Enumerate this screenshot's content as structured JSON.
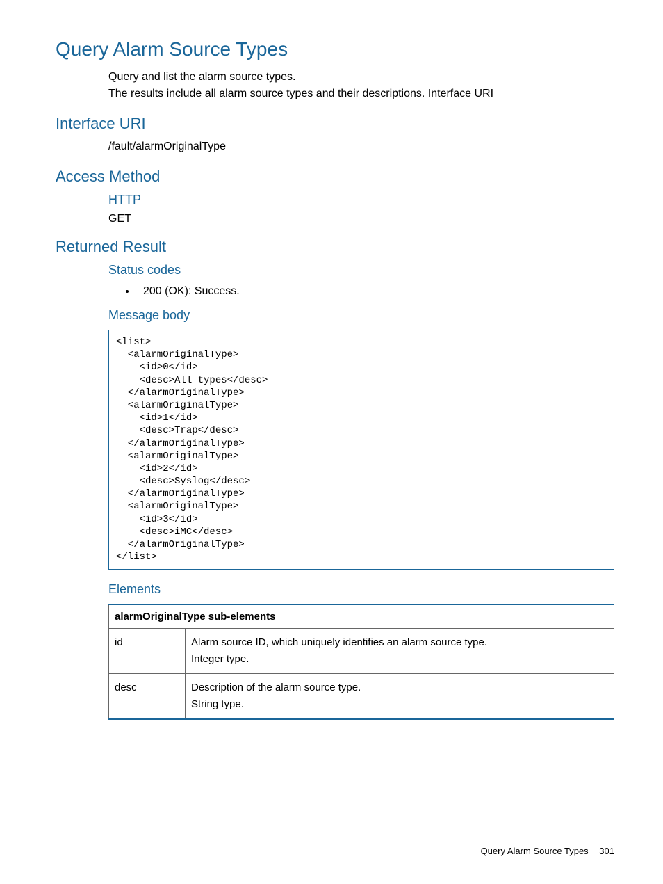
{
  "title": "Query Alarm Source Types",
  "intro_line1": "Query and list the alarm source types.",
  "intro_line2": "The results include all alarm source types and their descriptions. Interface URI",
  "interface_uri": {
    "heading": "Interface URI",
    "value": "/fault/alarmOriginalType"
  },
  "access_method": {
    "heading": "Access Method",
    "protocol_heading": "HTTP",
    "method": "GET"
  },
  "returned_result": {
    "heading": "Returned Result",
    "status_codes_heading": "Status codes",
    "status_codes": [
      "200 (OK): Success."
    ],
    "message_body_heading": "Message body",
    "message_body_code": "<list>\n  <alarmOriginalType>\n    <id>0</id>\n    <desc>All types</desc>\n  </alarmOriginalType>\n  <alarmOriginalType>\n    <id>1</id>\n    <desc>Trap</desc>\n  </alarmOriginalType>\n  <alarmOriginalType>\n    <id>2</id>\n    <desc>Syslog</desc>\n  </alarmOriginalType>\n  <alarmOriginalType>\n    <id>3</id>\n    <desc>iMC</desc>\n  </alarmOriginalType>\n</list>",
    "elements_heading": "Elements",
    "table_header": "alarmOriginalType sub-elements",
    "table_rows": [
      {
        "name": "id",
        "desc_line1": "Alarm source ID, which uniquely identifies an alarm source type.",
        "desc_line2": "Integer type."
      },
      {
        "name": "desc",
        "desc_line1": "Description of the alarm source type.",
        "desc_line2": "String type."
      }
    ]
  },
  "footer": {
    "title": "Query Alarm Source Types",
    "page": "301"
  }
}
